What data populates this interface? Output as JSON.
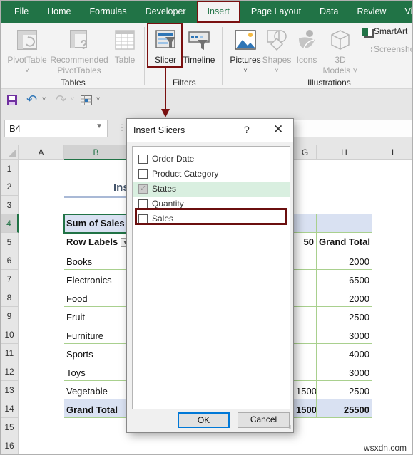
{
  "ribbon_tabs": [
    "File",
    "Home",
    "Formulas",
    "Developer",
    "Insert",
    "Page Layout",
    "Data",
    "Review",
    "View"
  ],
  "active_tab": "Insert",
  "groups": {
    "tables": {
      "label": "Tables",
      "buttons": [
        {
          "label": "PivotTable",
          "caret": "˅",
          "enabled": false
        },
        {
          "label": "Recommended",
          "label2": "PivotTables",
          "enabled": false
        },
        {
          "label": "Table",
          "enabled": false
        }
      ]
    },
    "filters": {
      "label": "Filters",
      "buttons": [
        {
          "label": "Slicer",
          "enabled": true
        },
        {
          "label": "Timeline",
          "enabled": true
        }
      ]
    },
    "illustrations": {
      "label": "Illustrations",
      "buttons": [
        {
          "label": "Pictures",
          "caret": "˅",
          "enabled": true
        },
        {
          "label": "Shapes",
          "caret": "˅",
          "enabled": false
        },
        {
          "label": "Icons",
          "enabled": false
        },
        {
          "label": "3D",
          "label2": "Models ˅",
          "enabled": false
        },
        {
          "label": "SmartArt",
          "enabled": true
        },
        {
          "label": "Screenshot",
          "enabled": false
        }
      ]
    }
  },
  "qat": {
    "save": "save-icon",
    "undo": "undo-icon",
    "redo": "redo-icon",
    "customize": "="
  },
  "name_box": "B4",
  "columns": [
    "A",
    "B",
    "G",
    "H",
    "I"
  ],
  "rows": [
    "1",
    "2",
    "3",
    "4",
    "5",
    "6",
    "7",
    "8",
    "9",
    "10",
    "11",
    "12",
    "13",
    "14",
    "15",
    "16"
  ],
  "sheet": {
    "title_partial": "Ins",
    "pivot_header": "Sum of Sales",
    "row_labels_header": "Row Labels",
    "g_header": "50",
    "grand_total_header": "Grand Total",
    "categories": [
      "Books",
      "Electronics",
      "Food",
      "Fruit",
      "Furniture",
      "Sports",
      "Toys",
      "Vegetable"
    ],
    "g_values": [
      "",
      "",
      "",
      "",
      "",
      "",
      "",
      "1500"
    ],
    "grand_totals": [
      "2000",
      "6500",
      "2000",
      "2500",
      "3000",
      "4000",
      "3000",
      "2500"
    ],
    "total_label": "Grand Total",
    "total_g": "1500",
    "total_value": "25500"
  },
  "dialog": {
    "title": "Insert Slicers",
    "help": "?",
    "close": "✕",
    "fields": [
      {
        "label": "Order Date",
        "checked": false
      },
      {
        "label": "Product Category",
        "checked": false
      },
      {
        "label": "States",
        "checked": true
      },
      {
        "label": "Quantity",
        "checked": false
      },
      {
        "label": "Sales",
        "checked": false
      }
    ],
    "ok": "OK",
    "cancel": "Cancel"
  },
  "watermark": "wsxdn.com"
}
